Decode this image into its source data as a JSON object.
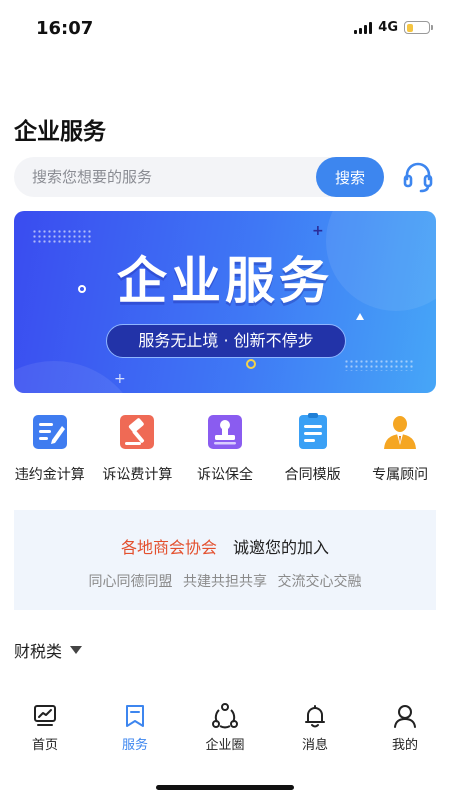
{
  "status_bar": {
    "time": "16:07",
    "network": "4G",
    "battery_level": 0.3
  },
  "page": {
    "title": "企业服务"
  },
  "search": {
    "placeholder": "搜索您想要的服务",
    "button_label": "搜索",
    "support_icon": "headset-icon"
  },
  "banner": {
    "title": "企业服务",
    "subtitle": "服务无止境 · 创新不停步"
  },
  "services": [
    {
      "label": "违约金计算",
      "icon": "pencil-document-icon",
      "color": "#3f7cf0"
    },
    {
      "label": "诉讼费计算",
      "icon": "gavel-icon",
      "color": "#ef6a55"
    },
    {
      "label": "诉讼保全",
      "icon": "stamp-icon",
      "color": "#8a5cf0"
    },
    {
      "label": "合同模版",
      "icon": "contract-document-icon",
      "color": "#3aa0f5"
    },
    {
      "label": "专属顾问",
      "icon": "advisor-icon",
      "color": "#f5a623"
    }
  ],
  "promo": {
    "highlight": "各地商会协会",
    "text": "诚邀您的加入",
    "slogan": "同心同德同盟 共建共担共享 交流交心交融"
  },
  "category": {
    "label": "财税类"
  },
  "tabs": [
    {
      "label": "首页",
      "icon": "chart-monitor-icon",
      "active": false
    },
    {
      "label": "服务",
      "icon": "bookmark-icon",
      "active": true
    },
    {
      "label": "企业圈",
      "icon": "circle-network-icon",
      "active": false
    },
    {
      "label": "消息",
      "icon": "bell-icon",
      "active": false
    },
    {
      "label": "我的",
      "icon": "user-icon",
      "active": false
    }
  ],
  "colors": {
    "accent": "#3d86ef",
    "highlight": "#e3502e",
    "banner_start": "#3a4cf0",
    "banner_end": "#46a6f7"
  }
}
